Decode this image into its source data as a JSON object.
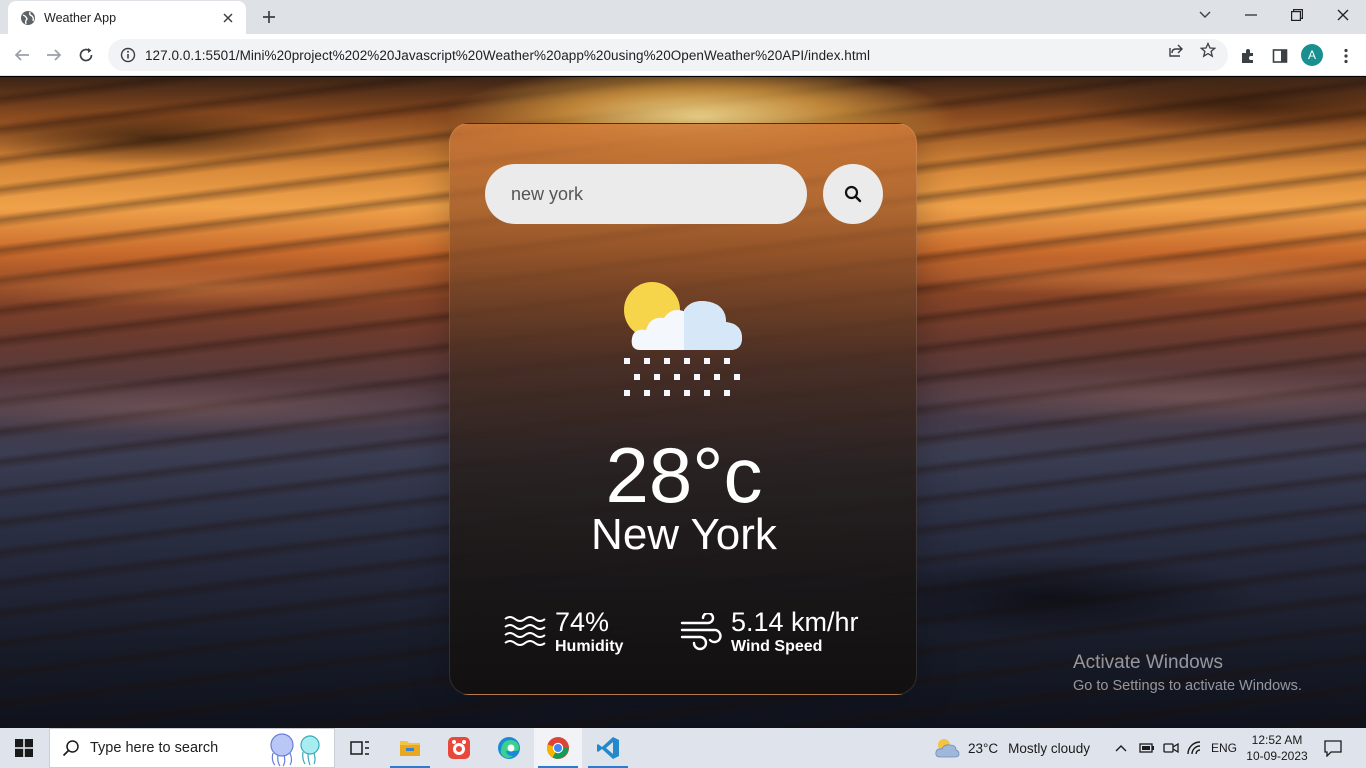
{
  "browser": {
    "tab_title": "Weather App",
    "url": "127.0.0.1:5501/Mini%20project%202%20Javascript%20Weather%20app%20using%20OpenWeather%20API/index.html",
    "profile_initial": "A"
  },
  "app": {
    "search_value": "new york",
    "temperature": "28°c",
    "city": "New York",
    "humidity_value": "74%",
    "humidity_label": "Humidity",
    "wind_value": "5.14 km/hr",
    "wind_label": "Wind Speed",
    "weather_icon": "snow-with-sun-icon"
  },
  "watermark": {
    "line1": "Activate Windows",
    "line2": "Go to Settings to activate Windows."
  },
  "taskbar": {
    "search_placeholder": "Type here to search",
    "weather_temp": "23°C",
    "weather_text": "Mostly cloudy",
    "language": "ENG",
    "time": "12:52 AM",
    "date": "10-09-2023"
  }
}
